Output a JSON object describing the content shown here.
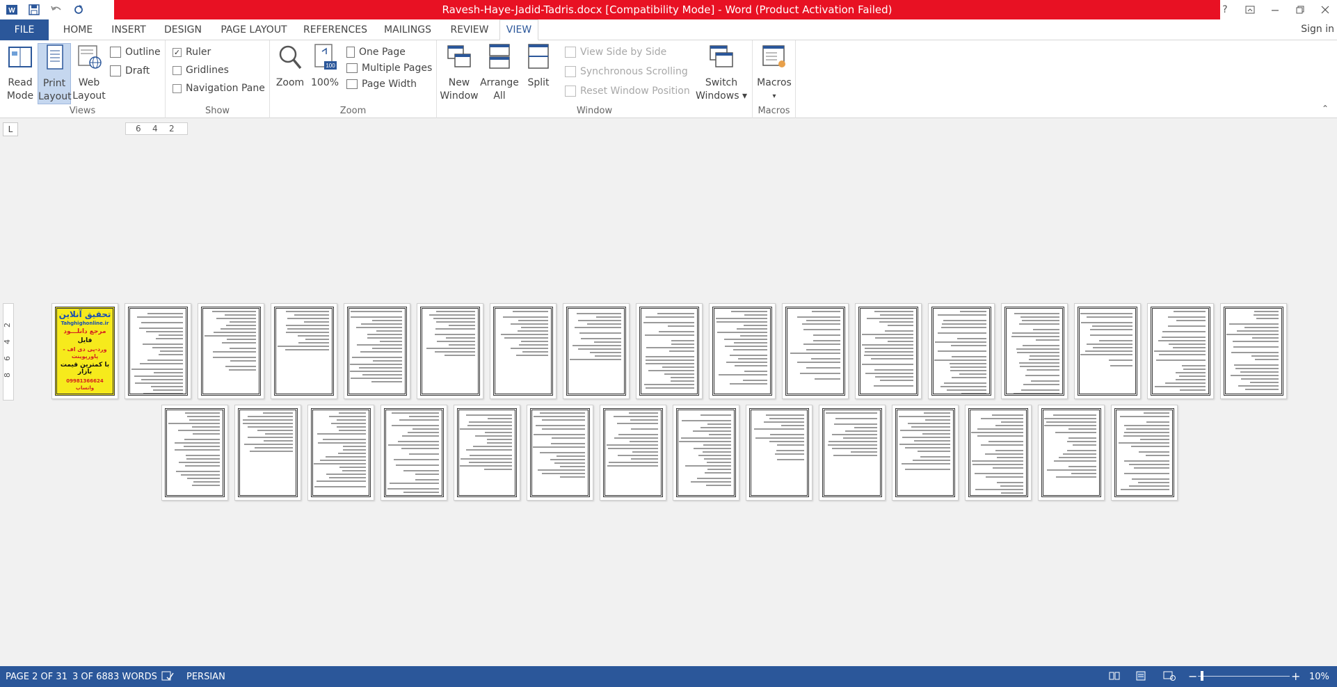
{
  "title_bar": {
    "title": "Ravesh-Haye-Jadid-Tadris.docx [Compatibility Mode] -  Word (Product Activation Failed)",
    "qat": [
      "word-icon",
      "save-icon",
      "undo-icon",
      "redo-icon"
    ],
    "controls": [
      "?",
      "ribbon-display-icon",
      "minimize-icon",
      "restore-icon",
      "close-icon"
    ]
  },
  "tabs": {
    "file": "FILE",
    "home": "HOME",
    "insert": "INSERT",
    "design": "DESIGN",
    "page_layout": "PAGE LAYOUT",
    "references": "REFERENCES",
    "mailings": "MAILINGS",
    "review": "REVIEW",
    "view": "VIEW",
    "sign_in": "Sign in"
  },
  "ribbon": {
    "views": {
      "label": "Views",
      "read_mode": [
        "Read",
        "Mode"
      ],
      "print_layout": [
        "Print",
        "Layout"
      ],
      "web_layout": [
        "Web",
        "Layout"
      ],
      "outline": "Outline",
      "draft": "Draft"
    },
    "show": {
      "label": "Show",
      "ruler": "Ruler",
      "ruler_checked": "✓",
      "gridlines": "Gridlines",
      "navigation_pane": "Navigation Pane"
    },
    "zoom": {
      "label": "Zoom",
      "zoom": "Zoom",
      "hundred": "100%",
      "hundred_badge": "100",
      "one_page": "One Page",
      "multiple_pages": "Multiple Pages",
      "page_width": "Page Width"
    },
    "window": {
      "label": "Window",
      "new_window": [
        "New",
        "Window"
      ],
      "arrange_all": [
        "Arrange",
        "All"
      ],
      "split": "Split",
      "view_side_by_side": "View Side by Side",
      "synchronous_scrolling": "Synchronous Scrolling",
      "reset_window_position": "Reset Window Position",
      "switch_windows": [
        "Switch",
        "Windows ▾"
      ]
    },
    "macros": {
      "label": "Macros",
      "macros": [
        "Macros",
        "▾"
      ]
    },
    "collapse": "⌃"
  },
  "ruler": {
    "corner": "L",
    "h_ticks": [
      "6",
      "4",
      "2"
    ],
    "v_ticks": [
      "2",
      "4",
      "6",
      "8"
    ]
  },
  "cover_page": {
    "line1": "تحقیق آنلاین",
    "line2": "Tahghighonline.ir",
    "line3": "مرجع دانلـــود",
    "line4": "فایل",
    "line5": "ورد-پی دی اف - پاورپوینت",
    "line6": "با کمترین قیمت بازار",
    "line7": "09981366624 واتساپ"
  },
  "pages": {
    "total": 31,
    "row1_count": 17,
    "row2_count": 14
  },
  "status_bar": {
    "page": "PAGE 2 OF 31",
    "words": "3 OF 6883 WORDS",
    "proofing_icon": "proofing-icon",
    "language": "PERSIAN",
    "zoom_minus": "−",
    "zoom_plus": "+",
    "zoom_level": "10%",
    "zoom_fraction": 0.1
  }
}
